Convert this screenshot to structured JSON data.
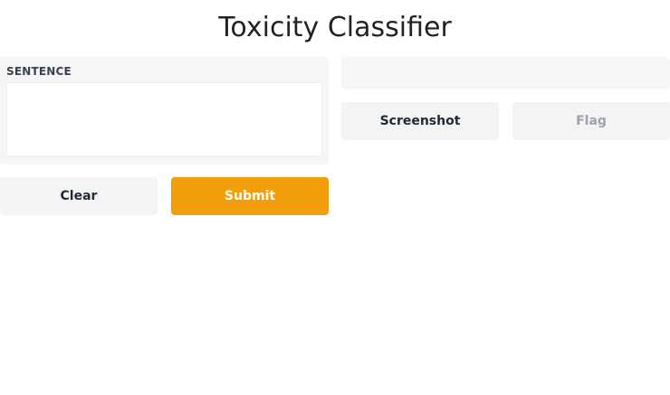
{
  "app": {
    "title": "Toxicity Classifier"
  },
  "input": {
    "label": "SENTENCE",
    "value": "",
    "placeholder": ""
  },
  "actions": {
    "clear_label": "Clear",
    "submit_label": "Submit"
  },
  "output": {
    "value": "",
    "screenshot_label": "Screenshot",
    "flag_label": "Flag"
  },
  "colors": {
    "accent": "#f59e0b",
    "panel_background": "#f6f6f7",
    "secondary_button": "#f4f4f5"
  }
}
